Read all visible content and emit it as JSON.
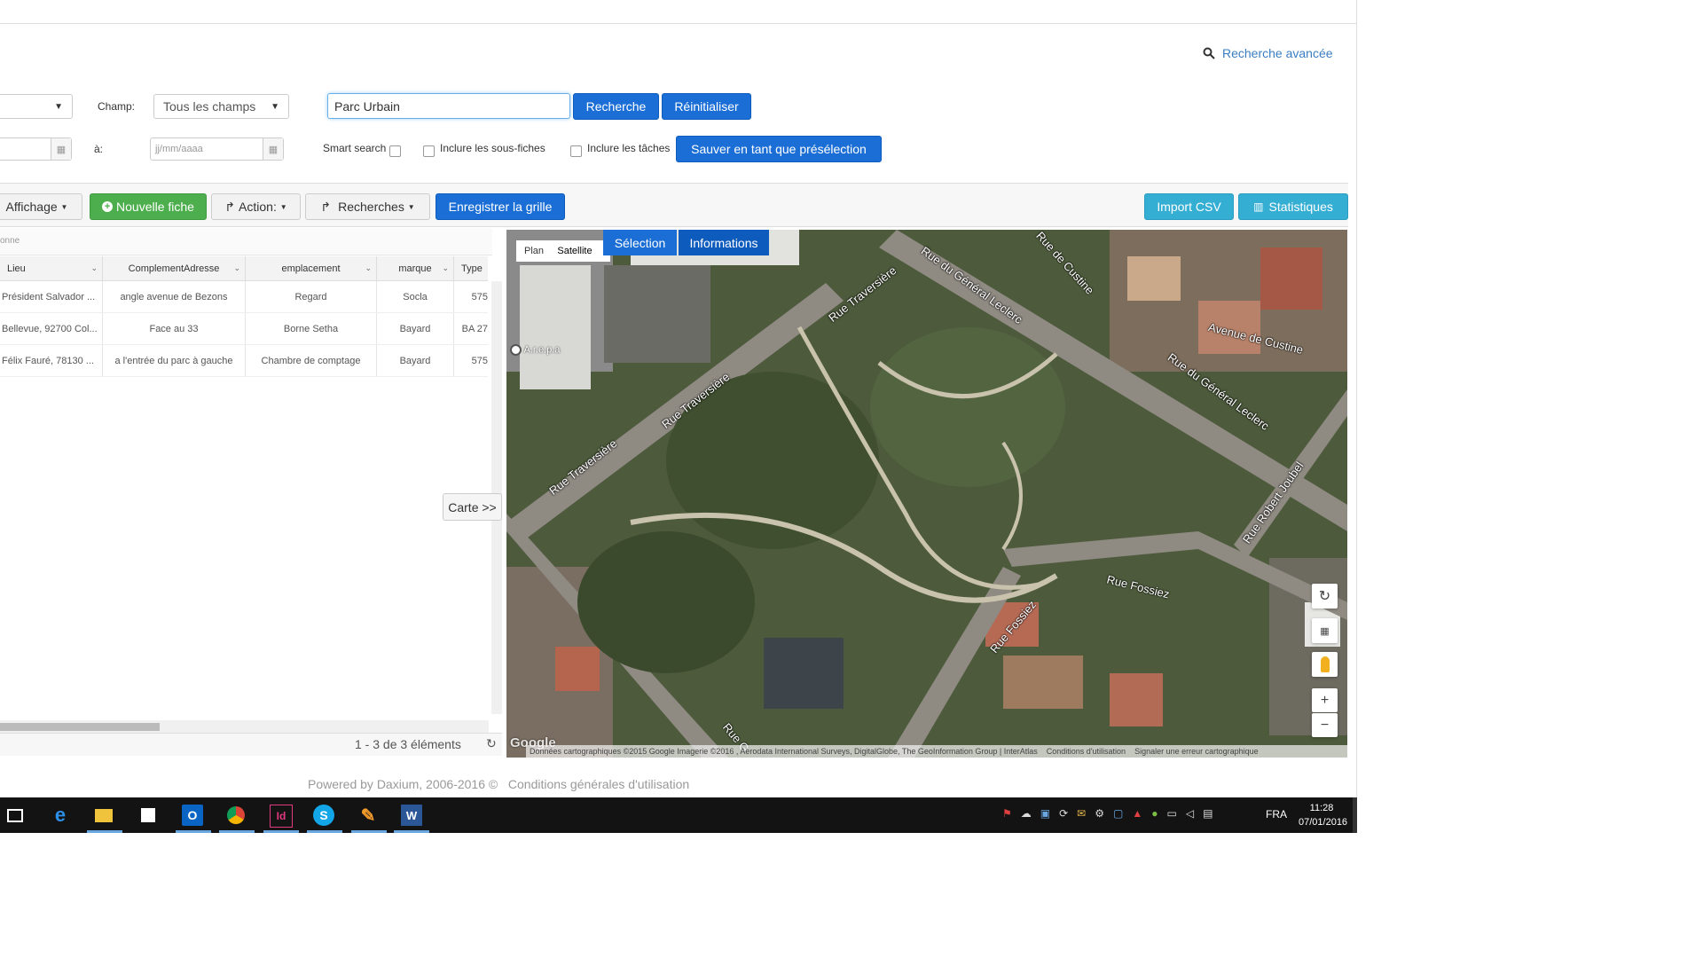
{
  "header": {
    "advanced_search": "Recherche avancée"
  },
  "filters": {
    "champ_label": "Champ:",
    "champ_value": "Tous les champs",
    "search_value": "Parc Urbain",
    "search_button": "Recherche",
    "reset_button": "Réinitialiser",
    "date_to_label": "à:",
    "date_placeholder": "jj/mm/aaaa",
    "smart_search": "Smart search",
    "include_subforms": "Inclure les sous-fiches",
    "include_tasks": "Inclure les tâches",
    "save_preset": "Sauver en tant que présélection"
  },
  "toolbar": {
    "display": "Affichage",
    "new_record": "Nouvelle fiche",
    "action": "Action:",
    "searches": "Recherches",
    "save_grid": "Enregistrer la grille",
    "import_csv": "Import CSV",
    "stats": "Statistiques"
  },
  "grid": {
    "group_hint": "onne",
    "columns": [
      "Lieu",
      "ComplementAdresse",
      "emplacement",
      "marque",
      "Type"
    ],
    "rows": [
      [
        "Président Salvador ...",
        "angle avenue de Bezons",
        "Regard",
        "Socla",
        "575"
      ],
      [
        "Bellevue, 92700 Col...",
        "Face au 33",
        "Borne Setha",
        "Bayard",
        "BA 27"
      ],
      [
        "Félix Fauré, 78130 ...",
        "a l'entrée du parc à gauche",
        "Chambre de comptage",
        "Bayard",
        "575"
      ]
    ],
    "pager": "1 - 3 de 3 éléments",
    "map_toggle": "Carte >>"
  },
  "map": {
    "type_plan": "Plan",
    "type_satellite": "Satellite",
    "tab_selection": "Sélection",
    "tab_info": "Informations",
    "poi": "A.r.e.p.a",
    "streets": [
      "Rue Traversière",
      "Rue du Général Leclerc",
      "Rue de Custine",
      "Avenue de Custine",
      "Rue du Général Leclerc",
      "Rue Traversière",
      "Rue Traversière",
      "Rue Robert Joubel",
      "Rue Fossiez",
      "Rue Fossiez",
      "Rue G"
    ],
    "attribution": "Données cartographiques ©2015 Google Imagerie ©2016 , Aerodata International Surveys, DigitalGlobe, The GeoInformation Group | InterAtlas",
    "terms": "Conditions d'utilisation",
    "report": "Signaler une erreur cartographique",
    "google": "Google"
  },
  "footer": {
    "powered": "Powered by Daxium, 2006-2016 ©",
    "terms": "Conditions générales d'utilisation"
  },
  "taskbar": {
    "lang": "FRA",
    "time": "11:28",
    "date": "07/01/2016"
  }
}
